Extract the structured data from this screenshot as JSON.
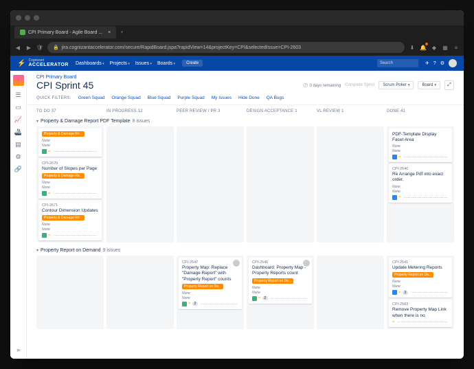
{
  "browser": {
    "tab_title": "CPI Primary Board - Agile Board ...",
    "url": "jira.cognizantaccelerator.com/secure/RapidBoard.jspa?rapidView=14&projectKey=CPI&selectedIssue=CPI-2603"
  },
  "top_nav": {
    "brand_small": "Cognizant",
    "brand_big": "ACCELERATOR",
    "menu": [
      "Dashboards",
      "Projects",
      "Issues",
      "Boards"
    ],
    "create": "Create",
    "search_placeholder": "Search"
  },
  "header": {
    "breadcrumb": "CPI Primary Board",
    "title": "CPI Sprint 45",
    "remaining": "0 days remaining",
    "complete": "Complete Sprint",
    "scrum_poker": "Scrum Poker",
    "board_btn": "Board"
  },
  "quick_filters": {
    "label": "QUICK FILTERS:",
    "items": [
      "Green Squad",
      "Orange Squad",
      "Blue Squad",
      "Purple Squad",
      "My Issues",
      "Hide Done",
      "QA Bugs"
    ]
  },
  "columns": [
    {
      "name": "TO DO",
      "count": 37
    },
    {
      "name": "IN PROGRESS",
      "count": 12
    },
    {
      "name": "PEER REVIEW / PR",
      "count": 3
    },
    {
      "name": "DESIGN ACCEPTANCE",
      "count": 1
    },
    {
      "name": "VL REVIEW",
      "count": 1
    },
    {
      "name": "DONE",
      "count": 41
    }
  ],
  "swimlanes": [
    {
      "title": "Property & Damage Report PDF Template",
      "count": "8 issues",
      "cols": {
        "todo": [
          {
            "id": "",
            "title": "",
            "epic": "Property & Damage Re...",
            "none1": "None",
            "none2": "None",
            "type": "story",
            "sp": ""
          },
          {
            "id": "CPI-2670",
            "title": "Number of Slopes per Page",
            "epic": "Property & Damage Re...",
            "none1": "None",
            "none2": "None",
            "type": "story",
            "sp": ""
          },
          {
            "id": "CPI-2671",
            "title": "Contour Dimension Updates",
            "epic": "Property & Damage Re...",
            "none1": "None",
            "none2": "None",
            "type": "story",
            "sp": ""
          }
        ],
        "done": [
          {
            "id": "",
            "title": "PDF-Template Display Facet Area",
            "epic": "",
            "none1": "None",
            "none2": "None",
            "type": "task",
            "sp": ""
          },
          {
            "id": "CPI-2640",
            "title": "Re Arrange Pdf into exact order.",
            "epic": "",
            "none1": "None",
            "none2": "None",
            "type": "task",
            "sp": ""
          }
        ]
      }
    },
    {
      "title": "Property Report on Demand",
      "count": "9 issues",
      "cols": {
        "peer": [
          {
            "id": "CPI-2547",
            "title": "Property Map: Replace \"Damage Report\" with \"Property Report\" counts",
            "epic": "Property Report on De...",
            "none1": "None",
            "none2": "None",
            "type": "story",
            "sp": "2",
            "avatar": true
          }
        ],
        "design": [
          {
            "id": "CPI-2546",
            "title": "Dashboard: Property Map - Property Reports count",
            "epic": "Property Report on De...",
            "none1": "None",
            "none2": "None",
            "type": "story",
            "sp": "2",
            "avatar": true
          }
        ],
        "done": [
          {
            "id": "CPI-2541",
            "title": "Update Metering Reports",
            "epic": "Property Report on De...",
            "none1": "None",
            "none2": "None",
            "type": "task",
            "sp": "3"
          },
          {
            "id": "CPI-2583",
            "title": "Remove Property Map Link when there is no",
            "epic": "",
            "none1": "",
            "none2": "",
            "type": "",
            "sp": ""
          }
        ]
      }
    }
  ]
}
